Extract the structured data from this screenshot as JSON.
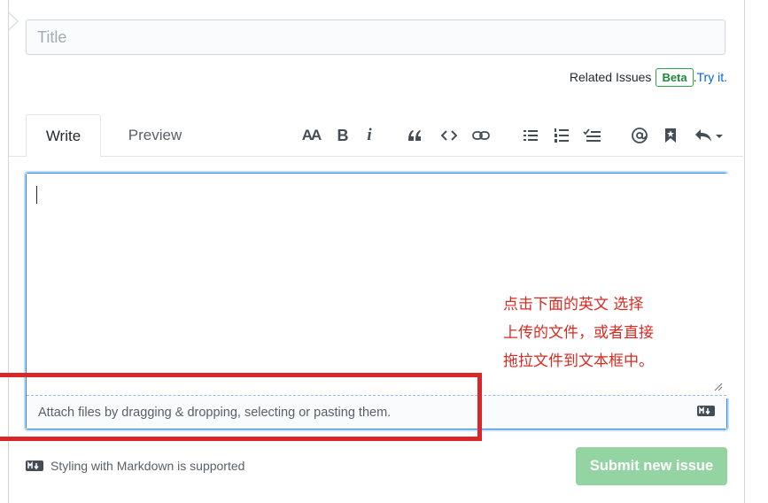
{
  "title_field": {
    "placeholder": "Title",
    "value": ""
  },
  "related": {
    "label": "Related Issues",
    "badge": "Beta",
    "separator": ".",
    "link": "Try it."
  },
  "tabs": [
    {
      "label": "Write",
      "active": true
    },
    {
      "label": "Preview",
      "active": false
    }
  ],
  "toolbar": {
    "heading": "AA",
    "bold": "B",
    "italic": "i",
    "icons": [
      "heading-icon",
      "bold-icon",
      "italic-icon",
      "quote-icon",
      "code-icon",
      "link-icon",
      "bulleted-list-icon",
      "numbered-list-icon",
      "task-list-icon",
      "mention-icon",
      "bookmark-icon",
      "reply-icon"
    ]
  },
  "editor": {
    "value": "",
    "drop_text": "Attach files by dragging & dropping, selecting or pasting them."
  },
  "footer": {
    "markdown_note": "Styling with Markdown is supported",
    "submit_label": "Submit new issue"
  },
  "annotation": {
    "lines": [
      "点击下面的英文 选择",
      "上传的文件，或者直接",
      "拖拉文件到文本框中。"
    ],
    "color": "#d92a22"
  },
  "colors": {
    "accent": "#0366d6",
    "submit_disabled": "#94d3a2",
    "highlight_box": "#d8262b"
  }
}
